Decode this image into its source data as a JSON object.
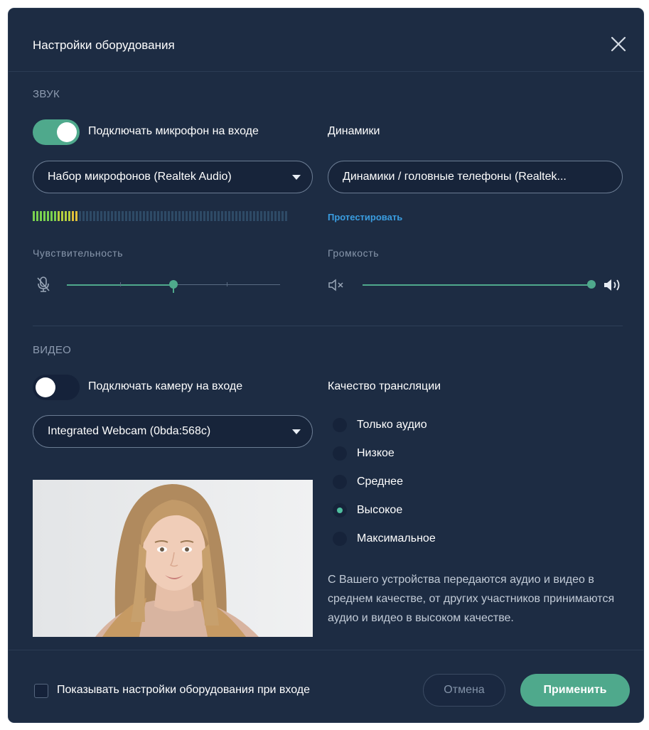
{
  "dialog": {
    "title": "Настройки оборудования"
  },
  "audio": {
    "section_label": "ЗВУК",
    "mic_toggle": {
      "label": "Подключать микрофон на входе",
      "on": true
    },
    "speakers_label": "Динамики",
    "mic_select": {
      "value": "Набор микрофонов (Realtek Audio)"
    },
    "speaker_select": {
      "value": "Динамики / головные телефоны (Realtek..."
    },
    "test_link": "Протестировать",
    "mic_level": {
      "active_segments": 13,
      "total_segments": 72
    },
    "sensitivity": {
      "label": "Чувствительность",
      "value": 0.5
    },
    "volume": {
      "label": "Громкость",
      "value": 1.0
    }
  },
  "video": {
    "section_label": "ВИДЕО",
    "camera_toggle": {
      "label": "Подключать камеру на входе",
      "on": false
    },
    "quality_label": "Качество трансляции",
    "camera_select": {
      "value": "Integrated Webcam (0bda:568c)"
    },
    "quality_options": [
      {
        "label": "Только аудио",
        "selected": false
      },
      {
        "label": "Низкое",
        "selected": false
      },
      {
        "label": "Среднее",
        "selected": false
      },
      {
        "label": "Высокое",
        "selected": true
      },
      {
        "label": "Максимальное",
        "selected": false
      }
    ],
    "note": "С Вашего устройства передаются аудио и видео в среднем качестве, от других участников принимаются аудио и видео в высоком качестве."
  },
  "footer": {
    "checkbox_label": "Показывать настройки оборудования при входе",
    "cancel_label": "Отмена",
    "apply_label": "Применить"
  },
  "colors": {
    "background": "#1d2c43",
    "accent": "#4fa98c",
    "link": "#3a9de0"
  }
}
